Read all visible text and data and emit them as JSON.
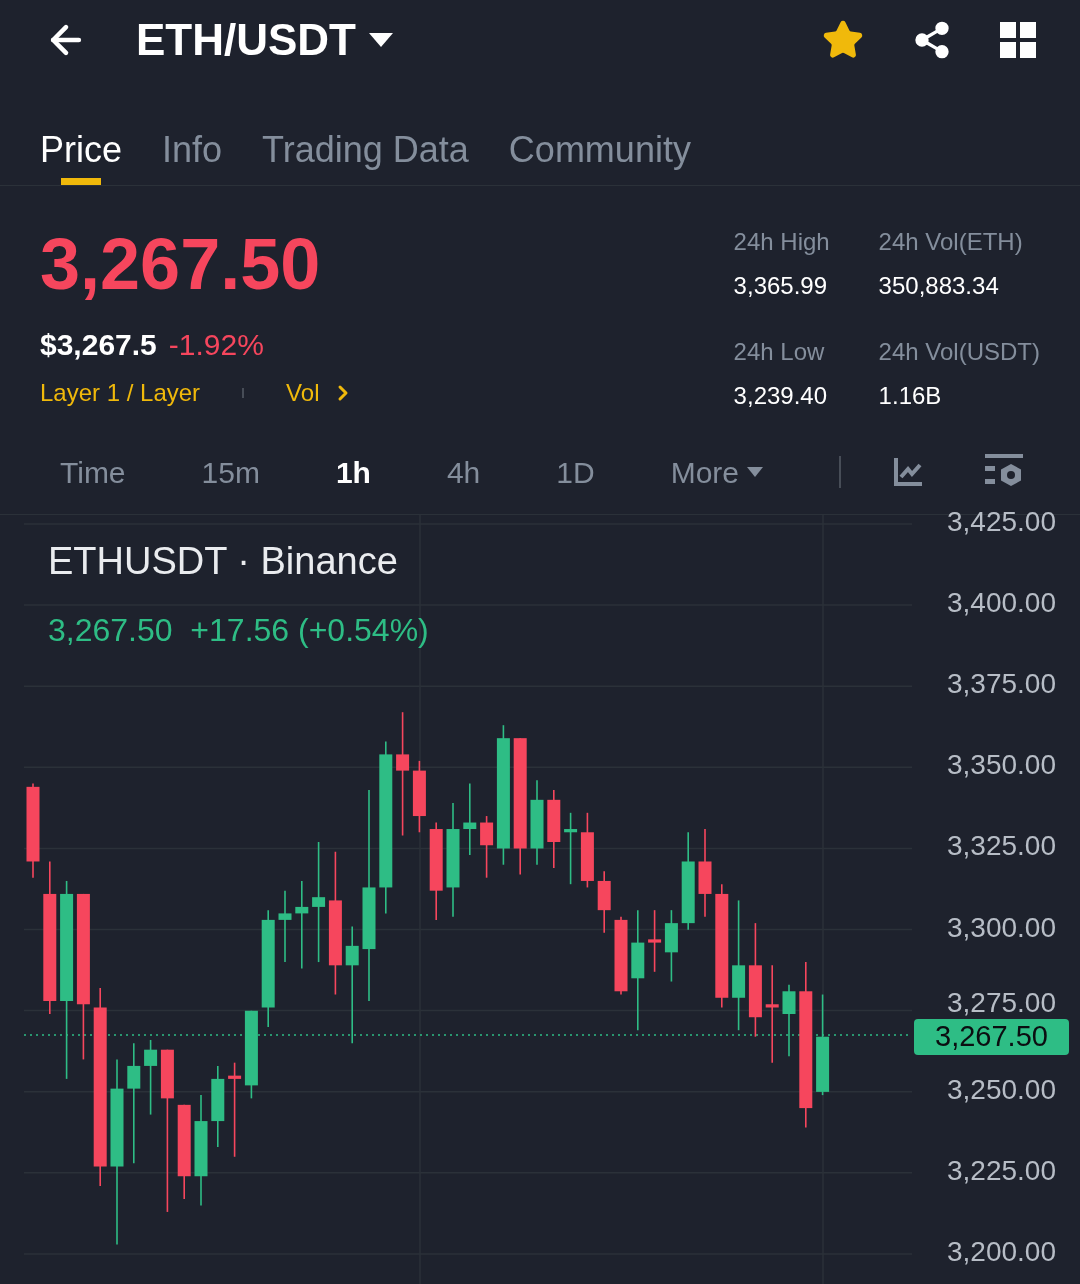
{
  "header": {
    "title": "ETH/USDT",
    "favorited": true
  },
  "tabs": [
    {
      "label": "Price",
      "selected": true
    },
    {
      "label": "Info",
      "selected": false
    },
    {
      "label": "Trading Data",
      "selected": false
    },
    {
      "label": "Community",
      "selected": false
    }
  ],
  "price": {
    "last": "3,267.50",
    "usd": "$3,267.5",
    "change": "-1.92%",
    "tags": [
      "Layer 1 / Layer",
      "Vol"
    ]
  },
  "stats": [
    {
      "label": "24h High",
      "value": "3,365.99"
    },
    {
      "label": "24h Vol(ETH)",
      "value": "350,883.34"
    },
    {
      "label": "24h Low",
      "value": "3,239.40"
    },
    {
      "label": "24h Vol(USDT)",
      "value": "1.16B"
    }
  ],
  "intervals": [
    {
      "label": "Time",
      "selected": false
    },
    {
      "label": "15m",
      "selected": false
    },
    {
      "label": "1h",
      "selected": true
    },
    {
      "label": "4h",
      "selected": false
    },
    {
      "label": "1D",
      "selected": false
    },
    {
      "label": "More",
      "selected": false
    }
  ],
  "chart": {
    "title": "ETHUSDT · Binance",
    "quote": "3,267.50  +17.56 (+0.54%)",
    "y_axis_labels": [
      "3,425.00",
      "3,400.00",
      "3,375.00",
      "3,350.00",
      "3,325.00",
      "3,300.00",
      "3,275.00",
      "3,250.00",
      "3,225.00",
      "3,200.00"
    ],
    "price_tag": "3,267.50"
  }
}
